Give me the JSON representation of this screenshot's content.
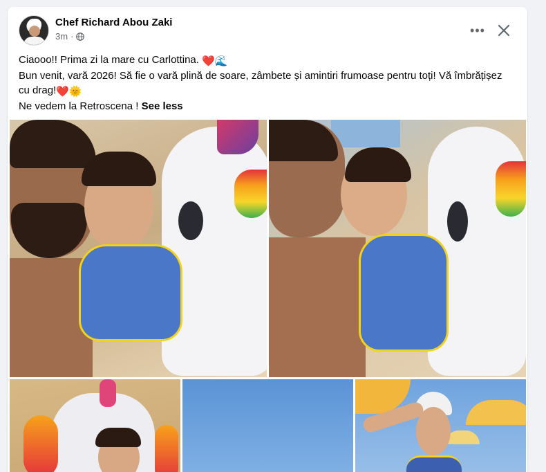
{
  "post": {
    "author": "Chef Richard Abou Zaki",
    "time": "3m",
    "more_label": "•••",
    "text_line1": "Ciaooo!! Prima zi la mare cu Carlottina.",
    "text_line2": "Bun venit, vară 2026! Să fie o vară plină de soare, zâmbete și amintiri frumoase pentru toți! Vă îmbrățișez",
    "text_line3": "cu drag!",
    "text_line4": "Ne vedem la Retroscena ! ",
    "see_less": "See less",
    "emoji_heart": "❤️",
    "emoji_wave": "🌊",
    "emoji_sun": "🌞"
  },
  "colors": {
    "text": "#050505",
    "secondary": "#65676b",
    "background": "#f0f2f5",
    "card": "#ffffff"
  },
  "icons": {
    "globe": "globe-icon",
    "more": "more-horizontal-icon",
    "close": "close-icon"
  }
}
